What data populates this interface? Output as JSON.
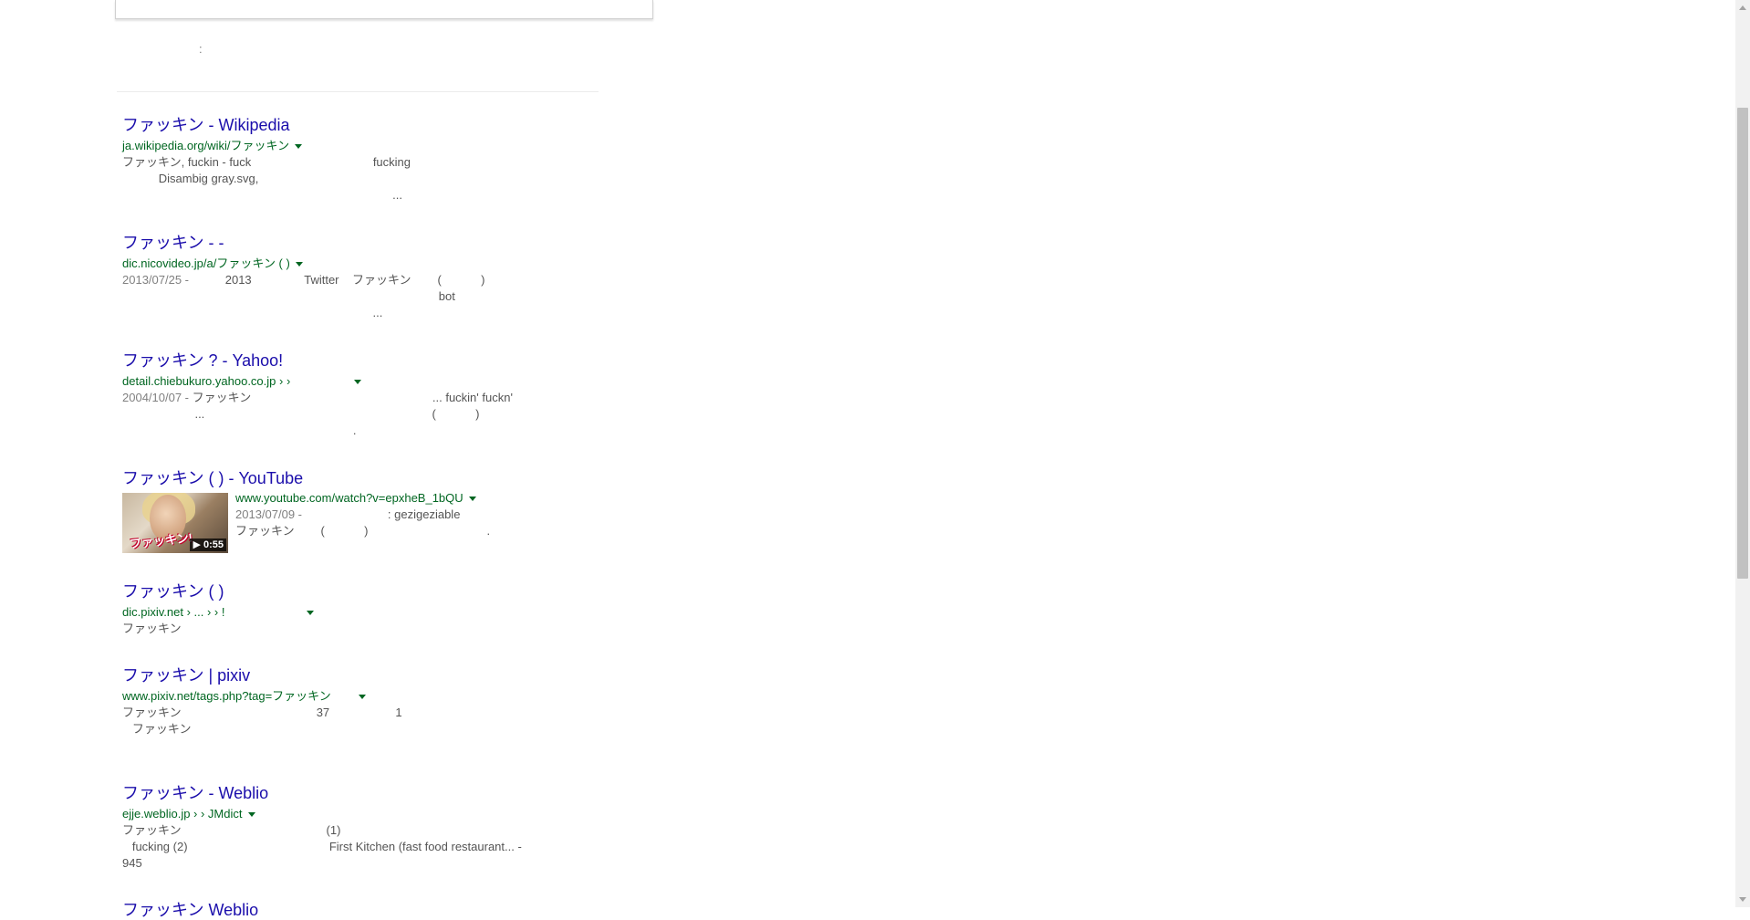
{
  "search": {
    "stats_text": ":"
  },
  "results": [
    {
      "title": "ファッキン - Wikipedia",
      "url": "ja.wikipedia.org/wiki/ファッキン",
      "snippet": [
        "ファッキン, fuckin - fuck                                     fucking",
        "           Disambig gray.svg,",
        "                                                                                  ..."
      ]
    },
    {
      "title": "ファッキン                              -                              -",
      "url": "dic.nicovideo.jp/a/ファッキン       (           )",
      "date": "2013/07/25 - ",
      "snippet": [
        "          2013                Twitter    ファッキン        (            )",
        "                                                                                                bot",
        "                                                                            ..."
      ]
    },
    {
      "title": "ファッキン                                          ? - Yahoo!",
      "url": "detail.chiebukuro.yahoo.co.jp ›                                       ›",
      "date": "2004/10/07 - ",
      "snippet": [
        "ファッキン                                                       ... fuckin' fuckn'",
        "                      ...                                                                     (            )",
        "                                                                      ."
      ]
    },
    {
      "title": "ファッキン          (              ) - YouTube",
      "url": "www.youtube.com/watch?v=epxheB_1bQU",
      "date": "2013/07/09 - ",
      "snippet": [
        "                         : gezigeziable",
        "ファッキン        (            )                                    ."
      ],
      "thumbnail": {
        "caption": "ファッキン!",
        "duration": "▶ 0:55"
      }
    },
    {
      "title": "ファッキン          (                 )",
      "url": "dic.pixiv.net › ... ›               ›         !",
      "snippet": [
        "ファッキン"
      ]
    },
    {
      "title": " ファッキン                                                          | pixiv",
      "url": "www.pixiv.net/tags.php?tag=ファッキン",
      "snippet": [
        "ファッキン                                         37                    1",
        "   ファッキン"
      ]
    },
    {
      "title": "ファッキン                        -                                  Weblio",
      "url": "ejje.weblio.jp ›                                 › JMdict",
      "snippet": [
        "ファッキン                                            (1)",
        "   fucking (2)                                           First Kitchen (fast food restaurant... -",
        "945"
      ]
    },
    {
      "title": "ファッキン                                                 Weblio",
      "url": "",
      "snippet": []
    }
  ],
  "colors": {
    "link": "#1a0dab",
    "url": "#006621",
    "snippet": "#545454",
    "date": "#808080"
  }
}
